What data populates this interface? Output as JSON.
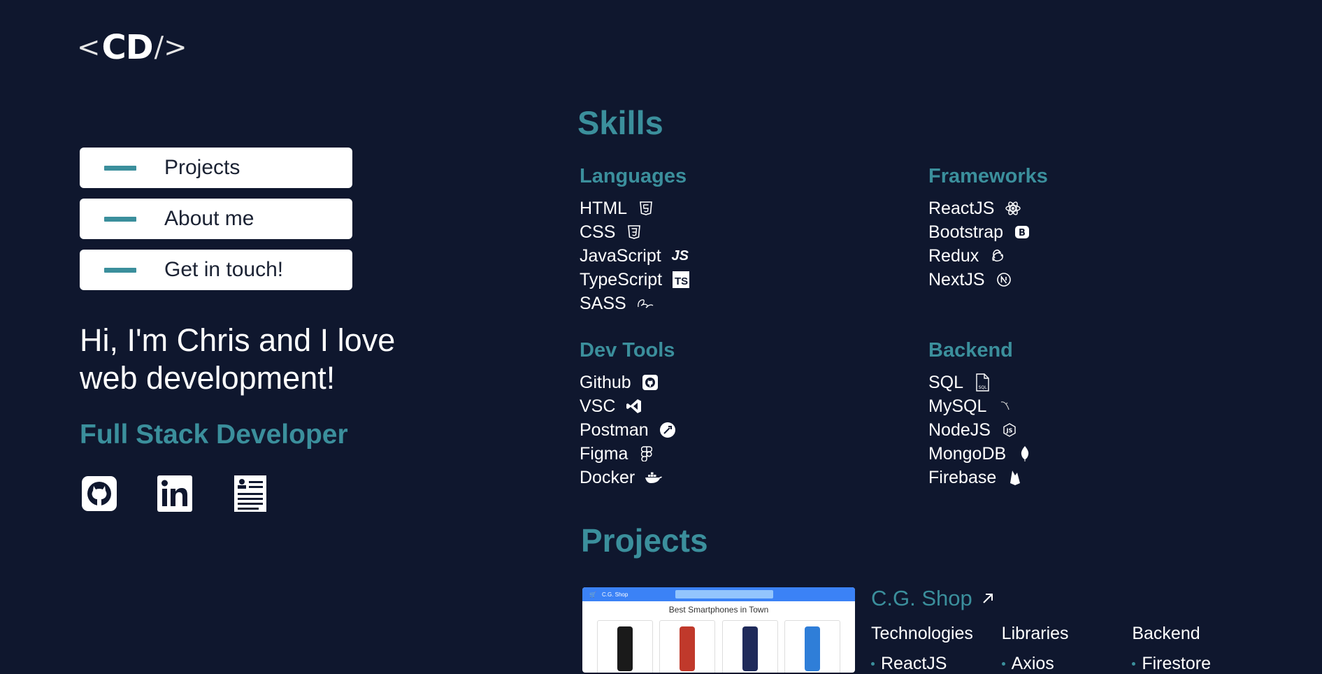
{
  "logo": {
    "open": "<",
    "text": "CD",
    "close": "/>"
  },
  "nav": [
    {
      "label": "Projects"
    },
    {
      "label": "About me"
    },
    {
      "label": "Get in touch!"
    }
  ],
  "hero": {
    "heading": "Hi, I'm Chris and I love web development!",
    "role": "Full Stack Developer"
  },
  "socials": [
    {
      "icon": "github-icon"
    },
    {
      "icon": "linkedin-icon"
    },
    {
      "icon": "resume-icon"
    }
  ],
  "skills": {
    "title": "Skills",
    "languages": {
      "title": "Languages",
      "items": [
        {
          "label": "HTML",
          "icon": "html5-icon"
        },
        {
          "label": "CSS",
          "icon": "css3-icon"
        },
        {
          "label": "JavaScript",
          "icon": "js-icon",
          "badge": "JS"
        },
        {
          "label": "TypeScript",
          "icon": "ts-icon",
          "badge": "TS"
        },
        {
          "label": "SASS",
          "icon": "sass-icon"
        }
      ]
    },
    "frameworks": {
      "title": "Frameworks",
      "items": [
        {
          "label": "ReactJS",
          "icon": "react-icon"
        },
        {
          "label": "Bootstrap",
          "icon": "bootstrap-icon"
        },
        {
          "label": "Redux",
          "icon": "redux-icon"
        },
        {
          "label": "NextJS",
          "icon": "nextjs-icon"
        }
      ]
    },
    "devtools": {
      "title": "Dev Tools",
      "items": [
        {
          "label": "Github",
          "icon": "github-icon"
        },
        {
          "label": "VSC",
          "icon": "vscode-icon"
        },
        {
          "label": "Postman",
          "icon": "postman-icon"
        },
        {
          "label": "Figma",
          "icon": "figma-icon"
        },
        {
          "label": "Docker",
          "icon": "docker-icon"
        }
      ]
    },
    "backend": {
      "title": "Backend",
      "items": [
        {
          "label": "SQL",
          "icon": "sql-file-icon"
        },
        {
          "label": "MySQL",
          "icon": "mysql-icon"
        },
        {
          "label": "NodeJS",
          "icon": "nodejs-icon"
        },
        {
          "label": "MongoDB",
          "icon": "mongodb-icon"
        },
        {
          "label": "Firebase",
          "icon": "firebase-icon"
        }
      ]
    }
  },
  "projects": {
    "title": "Projects",
    "items": [
      {
        "name": "C.G. Shop",
        "thumbnail": {
          "brand": "C.G. Shop",
          "heading": "Best Smartphones in Town",
          "phone_colors": [
            "#1a1a1a",
            "#c0392b",
            "#1f2a5a",
            "#2f7ed8"
          ]
        },
        "columns": [
          {
            "title": "Technologies",
            "items": [
              "ReactJS"
            ]
          },
          {
            "title": "Libraries",
            "items": [
              "Axios"
            ]
          },
          {
            "title": "Backend",
            "items": [
              "Firestore"
            ]
          }
        ]
      }
    ]
  },
  "colors": {
    "background": "#0f172e",
    "accent": "#3b8f9c",
    "text": "#ffffff"
  }
}
